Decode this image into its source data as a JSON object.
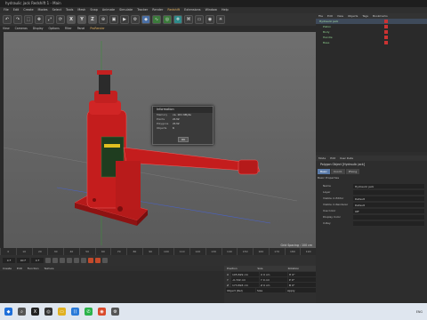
{
  "window": {
    "title": "hydraulic jack Redshift 1 - Main"
  },
  "menubar": [
    "File",
    "Edit",
    "Create",
    "Modes",
    "Select",
    "Tools",
    "Mesh",
    "Snap",
    "Animate",
    "Simulate",
    "Tracker",
    "Render",
    "Redshift",
    "Extensions",
    "Window",
    "Help"
  ],
  "toolbar": {
    "axis_buttons": [
      "X",
      "Y",
      "Z"
    ]
  },
  "viewport_menu": [
    "View",
    "Cameras",
    "Display",
    "Options",
    "Filter",
    "Panel",
    "ProRender"
  ],
  "viewport": {
    "grid_spacing": "Grid Spacing : 100 cm"
  },
  "info_dialog": {
    "title": "Information",
    "rows": [
      {
        "key": "Memory",
        "value": "ca. 161 KByte"
      },
      {
        "key": "Points",
        "value": "2132"
      },
      {
        "key": "Polygons",
        "value": "2132"
      },
      {
        "key": "Objects",
        "value": "6"
      }
    ],
    "ok_label": "OK"
  },
  "timeline": {
    "ticks": [
      "0",
      "10",
      "20",
      "30",
      "40",
      "50",
      "60",
      "70",
      "80",
      "90",
      "100",
      "110",
      "120",
      "130",
      "140",
      "150",
      "160",
      "170",
      "180",
      "190"
    ],
    "start_field": "0 F",
    "end_field": "90 F",
    "current_frame": "0 F"
  },
  "material_menu": [
    "Create",
    "Edit",
    "Function",
    "Texture"
  ],
  "coordinates": {
    "headers": [
      "Position",
      "Size",
      "Rotation"
    ],
    "rows": [
      {
        "axis": "X",
        "pos": "105.829 cm",
        "size": "X 0 cm",
        "rot": "H 0°"
      },
      {
        "axis": "Y",
        "pos": "-0.722 cm",
        "size": "Y 0 cm",
        "rot": "P 0°"
      },
      {
        "axis": "Z",
        "pos": "173.893 cm",
        "size": "Z 0 cm",
        "rot": "B 0°"
      }
    ],
    "mode": "Object (Rel)",
    "size_mode": "Size",
    "apply_label": "Apply"
  },
  "object_manager": {
    "menu": [
      "File",
      "Edit",
      "View",
      "Objects",
      "Tags",
      "Bookmarks"
    ],
    "items": [
      {
        "label": "Hydraulic jack",
        "selected": true
      },
      {
        "label": "Piston",
        "selected": false
      },
      {
        "label": "Body",
        "selected": false
      },
      {
        "label": "Handle",
        "selected": false
      },
      {
        "label": "Base",
        "selected": false
      }
    ]
  },
  "attributes": {
    "menu": [
      "Mode",
      "Edit",
      "User Data"
    ],
    "title": "Polygon Object [Hydraulic jack]",
    "tabs": [
      "Basic",
      "Coord.",
      "Phong"
    ],
    "section": "Basic Properties",
    "rows": [
      {
        "key": "Name",
        "value": "Hydraulic jack"
      },
      {
        "key": "Layer",
        "value": ""
      },
      {
        "key": "Visible in Editor",
        "value": "Default"
      },
      {
        "key": "Visible in Renderer",
        "value": "Default"
      },
      {
        "key": "Use Color",
        "value": "Off"
      },
      {
        "key": "Display Color",
        "value": ""
      },
      {
        "key": "X-Ray",
        "value": ""
      }
    ]
  },
  "taskbar": {
    "time": "ENG"
  }
}
